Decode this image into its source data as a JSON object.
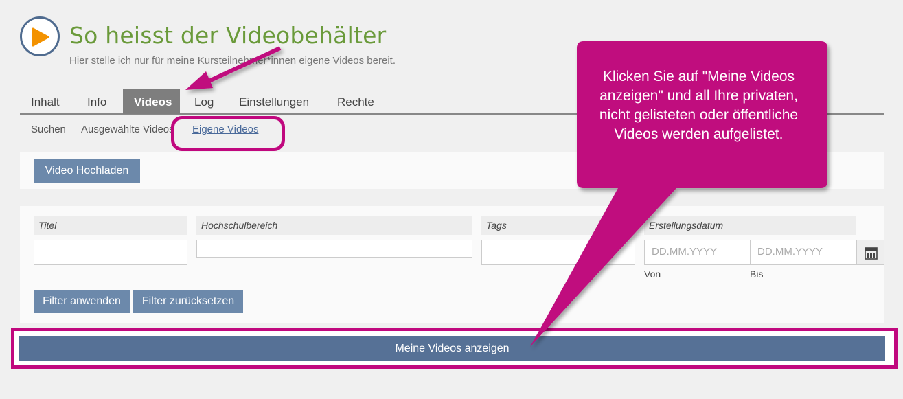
{
  "header": {
    "title": "So heisst der Videobehälter",
    "subtitle": "Hier stelle ich nur für meine Kursteilnehmer*innen eigene Videos bereit."
  },
  "tabs": [
    {
      "label": "Inhalt",
      "active": false
    },
    {
      "label": "Info",
      "active": false
    },
    {
      "label": "Videos",
      "active": true
    },
    {
      "label": "Log",
      "active": false
    },
    {
      "label": "Einstellungen",
      "active": false
    },
    {
      "label": "Rechte",
      "active": false
    }
  ],
  "subtabs": [
    {
      "label": "Suchen",
      "active": false
    },
    {
      "label": "Ausgewählte Videos",
      "active": false
    },
    {
      "label": "Eigene Videos",
      "active": true
    }
  ],
  "upload_button": "Video Hochladen",
  "filters": {
    "titel_label": "Titel",
    "hochschulbereich_label": "Hochschulbereich",
    "tags_label": "Tags",
    "datum_label": "Erstellungsdatum",
    "von_placeholder": "DD.MM.YYYY",
    "bis_placeholder": "DD.MM.YYYY",
    "von_label": "Von",
    "bis_label": "Bis",
    "apply_button": "Filter anwenden",
    "reset_button": "Filter zurücksetzen"
  },
  "meine_videos_button": "Meine Videos anzeigen",
  "callout": {
    "text": "Klicken Sie auf \"Meine Videos anzeigen\" und all Ihre privaten, nicht gelisteten oder öffentliche Videos werden aufgelistet.",
    "color": "#c0087e"
  },
  "colors": {
    "title_green": "#6a9a3a",
    "button_blue": "#6c89ab",
    "active_tab": "#7e7e7e",
    "annotation_magenta": "#c0087e"
  }
}
